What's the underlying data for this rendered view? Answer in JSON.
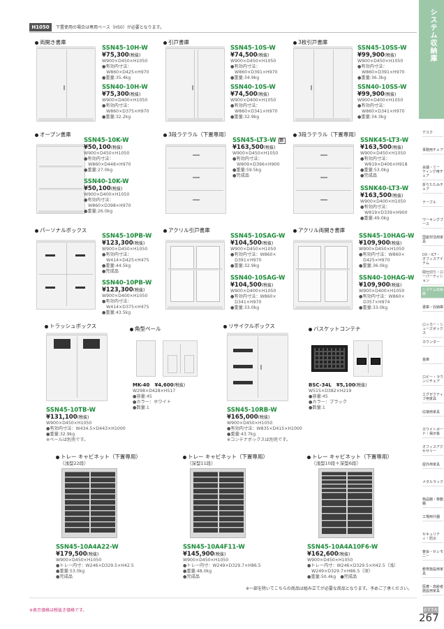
{
  "header": {
    "tag": "H1050",
    "note": "下置使用の場合は専用ベース（H50）が必要となります。"
  },
  "sidebar": {
    "title": "システム収納庫",
    "items": [
      "デスク",
      "事務用チェア",
      "会議・ミーティング用チェア",
      "折りたたみチェア",
      "テーブル",
      "ワーキングブース",
      "国産材活用家具",
      "DX・ICT・オフィスアイテム",
      "間仕切り・ローパーティション",
      "システム収納庫",
      "書庫・収納庫",
      "ロッカー・シューズボックス",
      "カウンター",
      "金庫",
      "ロビー・ラウンジチェア",
      "エグゼクティブ用家具",
      "応接用家具",
      "ホワイトボード・掲示板",
      "オフィスアクセサリー",
      "屋外用家具",
      "メタルラック",
      "物品棚・移動棚",
      "工場用什器",
      "セキュリティ・防災",
      "宴会・セレモニー",
      "教育施設用家具",
      "医療・高齢者施設用家具"
    ],
    "tag": "おすすめ"
  },
  "sections": [
    {
      "title": "両開き書庫",
      "products": [
        {
          "code": "SSN45-10H-W",
          "price": "¥75,300",
          "tax": "(税抜)",
          "spec": "W900×D450×H1050\n●有効内寸法：\n　W860×D425×H970\n●重量:35.4kg"
        },
        {
          "code": "SSN40-10H-W",
          "price": "¥75,300",
          "tax": "(税抜)",
          "spec": "W900×D400×H1050\n●有効内寸法：\n　W860×D375×H970\n●重量:32.2kg"
        }
      ]
    },
    {
      "title": "引戸書庫",
      "products": [
        {
          "code": "SSN45-10S-W",
          "price": "¥74,500",
          "tax": "(税抜)",
          "spec": "W900×D450×H1050\n●有効内寸法：\n　W860×D391×H970\n●重量:34.9kg"
        },
        {
          "code": "SSN40-10S-W",
          "price": "¥74,500",
          "tax": "(税抜)",
          "spec": "W900×D400×H1050\n●有効内寸法：\n　W860×D341×H970\n●重量:32.9kg"
        }
      ]
    },
    {
      "title": "3枚引戸書庫",
      "products": [
        {
          "code": "SSN45-10SS-W",
          "price": "¥99,900",
          "tax": "(税抜)",
          "spec": "W900×D450×H1050\n●有効内寸法：\n　W860×D391×H970\n●重量:36.3kg"
        },
        {
          "code": "SSN40-10SS-W",
          "price": "¥99,900",
          "tax": "(税抜)",
          "spec": "W900×D400×H1050\n●有効内寸法：\n　W860×D341×H970\n●重量:34.3kg"
        }
      ]
    },
    {
      "title": "オープン書庫",
      "products": [
        {
          "code": "SSN45-10K-W",
          "price": "¥50,100",
          "tax": "(税抜)",
          "spec": "W900×D450×H1050\n●有効内寸法：\n　W860×D448×H970\n●重量:27.0kg"
        },
        {
          "code": "SSN40-10K-W",
          "price": "¥50,100",
          "tax": "(税抜)",
          "spec": "W900×D400×H1050\n●有効内寸法：\n　W860×D398×H970\n●重量:26.0kg"
        }
      ]
    },
    {
      "title": "3段ラテラル（下置専用）",
      "products": [
        {
          "code": "SSN45-LT3-W",
          "badge": "数",
          "price": "¥163,500",
          "tax": "(税抜)",
          "spec": "W900×D450×H1050\n●有効内寸法：\n　W809×D396×H900\n●重量:59.5kg\n●完成品"
        }
      ]
    },
    {
      "title": "3段ラテラル（下置専用）",
      "products": [
        {
          "code": "SSNK45-LT3-W",
          "price": "¥163,500",
          "tax": "(税抜)",
          "spec": "W900×D450×H1050\n●有効内寸法：\n　W819×D406×H918\n●重量:53.0kg\n●完成品"
        },
        {
          "code": "SSNK40-LT3-W",
          "price": "¥163,500",
          "tax": "(税抜)",
          "spec": "W900×D400×H1050\n●有効内寸法：\n　W819×D339×H900\n●重量:49.0kg"
        }
      ]
    },
    {
      "title": "パーソナルボックス",
      "products": [
        {
          "code": "SSN45-10PB-W",
          "price": "¥123,300",
          "tax": "(税抜)",
          "spec": "W900×D450×H1050\n●有効内寸法：\n　W414×D425×H475\n●重量:44.5kg\n●完成品"
        },
        {
          "code": "SSN40-10PB-W",
          "price": "¥123,300",
          "tax": "(税抜)",
          "spec": "W900×D400×H1050\n●有効内寸法：\n　W414×D375×H475\n●重量:43.5kg"
        }
      ]
    },
    {
      "title": "アクリル引戸書庫",
      "products": [
        {
          "code": "SSN45-10SAG-W",
          "price": "¥104,500",
          "tax": "(税抜)",
          "spec": "W900×D450×H1050\n●有効内寸法：W860×\n　D391×H970\n●重量:32.9kg"
        },
        {
          "code": "SSN40-10SAG-W",
          "price": "¥104,500",
          "tax": "(税抜)",
          "spec": "W900×D400×H1050\n●有効内寸法：W860×\n　D341×H970\n●重量:33.0kg"
        }
      ]
    },
    {
      "title": "アクリル両開き書庫",
      "products": [
        {
          "code": "SSN45-10HAG-W",
          "price": "¥109,900",
          "tax": "(税抜)",
          "spec": "W900×D450×H1050\n●有効内寸法：W860×\n　D425×H970\n●重量:36.0kg"
        },
        {
          "code": "SSN40-10HAG-W",
          "price": "¥109,900",
          "tax": "(税抜)",
          "spec": "W900×D400×H1050\n●有効内寸法：W860×\n　D357×H974\n●重量:33.0kg"
        }
      ]
    },
    {
      "title": "トラッシュボックス",
      "products": [
        {
          "code": "SSN45-10TB-W",
          "price": "¥131,100",
          "tax": "(税抜)",
          "spec": "W900×D450×H1050\n●有効内寸法：W434.5×D443×H1000\n●重量:32.9kg\n※ペールは別売です。"
        }
      ]
    },
    {
      "title": "角型ペール",
      "products": [
        {
          "code": "MK-40",
          "price": "¥4,600",
          "tax": "(税抜)",
          "spec": "W298×D428×H517\n●容量:45\n●カラー：ホワイト\n●数量:1"
        }
      ]
    },
    {
      "title": "リサイクルボックス",
      "products": [
        {
          "code": "SSN45-10RB-W",
          "price": "¥165,000",
          "tax": "(税抜)",
          "spec": "W900×D450×H1050\n●有効内寸法：W835×D415×H1000\n●重量:43.7kg\n※コンテナボックスは別売です。"
        }
      ]
    },
    {
      "title": "バスケットコンテナ",
      "products": [
        {
          "code": "BSC-34L",
          "price": "¥5,100",
          "tax": "(税抜)",
          "spec": "W515×D382×H219\n●容量:45\n●カラー：ブラック\n●数量:1"
        }
      ]
    },
    {
      "title": "トレー キャビネット（下置専用）",
      "sub": "（浅型22段）",
      "products": [
        {
          "code": "SSN45-10A4A22-W",
          "price": "¥179,500",
          "tax": "(税抜)",
          "spec": "W900×D450×H1050\n●トレー内寸：W246×D329.5×H42.5\n●重量:53.0kg\n●完成品"
        }
      ]
    },
    {
      "title": "トレー キャビネット（下置専用）",
      "sub": "（深型11段）",
      "products": [
        {
          "code": "SSN45-10A4F11-W",
          "price": "¥145,900",
          "tax": "(税抜)",
          "spec": "W900×D450×H1050\n●トレー内寸：W249×D329.7×H86.5\n●重量:48.0kg\n●完成品"
        }
      ]
    },
    {
      "title": "トレー キャビネット（下置専用）",
      "sub": "（浅型10段＋深型6段）",
      "products": [
        {
          "code": "SSN45-10A4A10F6-W",
          "price": "¥162,600",
          "tax": "(税抜)",
          "spec": "W900×D450×H1050\n●トレー内寸：W246×D329.5×H42.5（浅）\n　W249×D329.7×H86.5（深）\n●重量:50.4kg　●完成品"
        }
      ]
    }
  ],
  "bottom_note": "※一部を除いてこちらの商品は組み立てが必要な商品となります。予めご了承ください。",
  "footnote": "※表示価格は税抜き価格です。",
  "page_number": "267"
}
